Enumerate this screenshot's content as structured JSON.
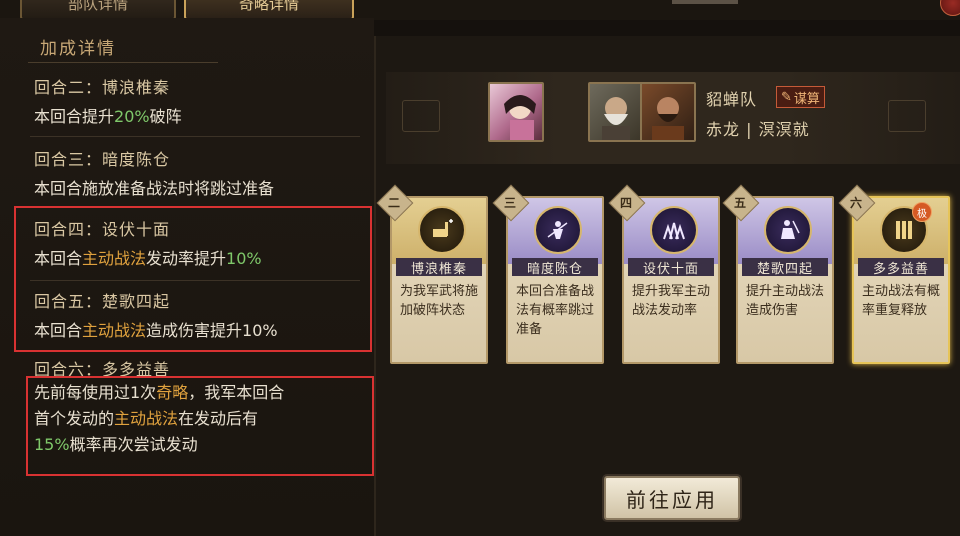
{
  "tabs": [
    {
      "label": "部队详情"
    },
    {
      "label": "奇略详情"
    }
  ],
  "bonus": {
    "title": "加成详情",
    "rounds": [
      {
        "name": "回合二：博浪椎秦",
        "desc_a": "本回合提升",
        "pct": "20%",
        "desc_b": "破阵"
      },
      {
        "name": "回合三：暗度陈仓",
        "desc": "本回合施放准备战法时将跳过准备"
      },
      {
        "name": "回合四：设伏十面",
        "desc_a": "本回合",
        "kw": "主动战法",
        "desc_b": "发动率提升",
        "pct": "10%"
      },
      {
        "name": "回合五：楚歌四起",
        "desc_a": "本回合",
        "kw": "主动战法",
        "desc_b": "造成伤害提升10%"
      },
      {
        "name": "回合六：多多益善",
        "l1_a": "先前每使用过1次",
        "l1_kw": "奇略",
        "l1_b": "，我军本回合",
        "l2_a": "首个发动的",
        "l2_kw": "主动战法",
        "l2_b": "在发动后有",
        "l3_pct": "15%",
        "l3_b": "概率再次尝试发动"
      }
    ]
  },
  "team": {
    "name": "貂蝉队",
    "tag": "谋算",
    "members": "赤龙 | 溟溟就"
  },
  "cards": [
    {
      "num": "二",
      "name": "博浪椎秦",
      "desc": "为我军武将施加破阵状态",
      "style": "gold"
    },
    {
      "num": "三",
      "name": "暗度陈仓",
      "desc": "本回合准备战法有概率跳过准备",
      "style": "purple"
    },
    {
      "num": "四",
      "name": "设伏十面",
      "desc": "提升我军主动战法发动率",
      "style": "purple"
    },
    {
      "num": "五",
      "name": "楚歌四起",
      "desc": "提升主动战法造成伤害",
      "style": "purple"
    },
    {
      "num": "六",
      "name": "多多益善",
      "desc": "主动战法有概率重复释放",
      "style": "gold",
      "tag": "极"
    }
  ],
  "apply_button": "前往应用",
  "colors": {
    "highlight_green": "#7fc86a",
    "highlight_orange": "#e0a23e",
    "annotation_red": "#d83232"
  }
}
